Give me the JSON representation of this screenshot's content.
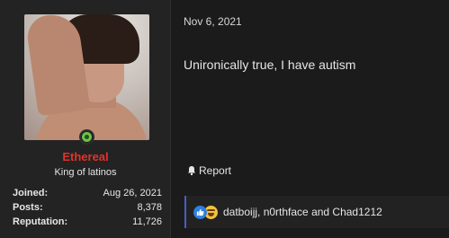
{
  "post": {
    "user": {
      "username": "Ethereal",
      "user_title": "King of latinos",
      "avatar_icon": "user-avatar-photo",
      "online_icon": "online-status-icon",
      "stats": [
        {
          "label": "Joined:",
          "value": "Aug 26, 2021"
        },
        {
          "label": "Posts:",
          "value": "8,378"
        },
        {
          "label": "Reputation:",
          "value": "11,726"
        }
      ]
    },
    "date": "Nov 6, 2021",
    "message": "Unironically true, I have autism",
    "report_label": "Report",
    "reactions": {
      "icons": [
        "like-reaction-icon",
        "haha-reaction-icon"
      ],
      "text": "datboijj, n0rthface and Chad1212"
    }
  },
  "colors": {
    "username": "#e2322b",
    "background": "#1b1b1b",
    "user_panel": "#232323",
    "reaction_accent": "#4b5cc4",
    "online": "#6cc24a"
  }
}
